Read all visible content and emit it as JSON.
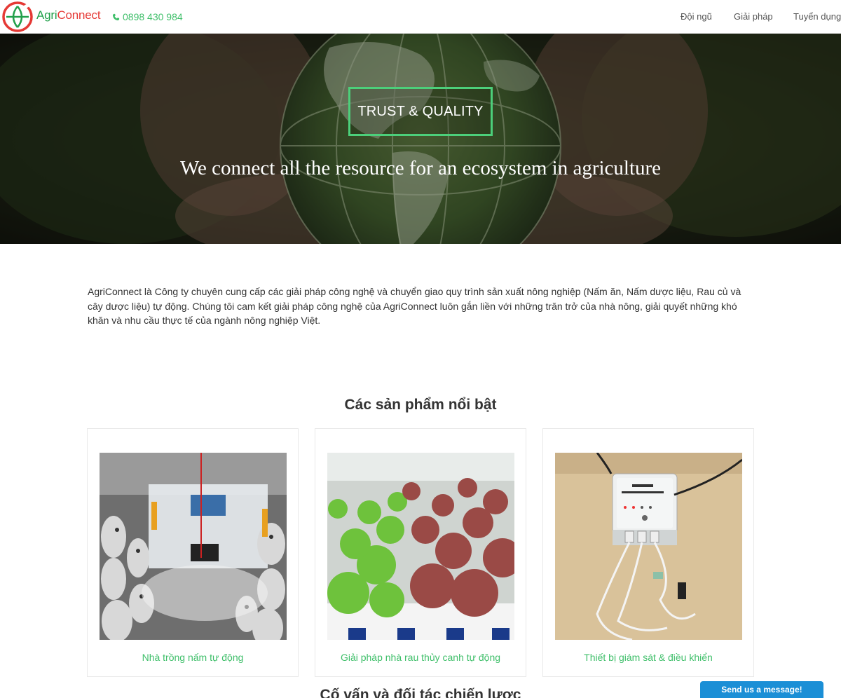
{
  "header": {
    "brand_part1": "Agri",
    "brand_part2": "Connect",
    "phone": "0898 430 984",
    "nav": [
      "Đội ngũ",
      "Giải pháp",
      "Tuyển dụng"
    ]
  },
  "hero": {
    "badge": "TRUST & QUALITY",
    "headline": "We connect all the resource for an ecosystem in agriculture"
  },
  "intro": {
    "text": "AgriConnect là Công ty chuyên cung cấp các giải pháp công nghệ và chuyển giao quy trình sản xuất nông nghiệp (Nấm ăn, Nấm dược liệu, Rau củ và cây dược liệu) tự động. Chúng tôi cam kết giải pháp công nghệ của AgriConnect luôn gắn liền với những trăn trở của nhà nông, giải quyết những khó khăn và nhu cầu thực tế của ngành nông nghiệp Việt."
  },
  "products": {
    "title": "Các sản phẩm nổi bật",
    "items": [
      {
        "caption": "Nhà trồng nấm tự động"
      },
      {
        "caption": "Giải pháp nhà rau thủy canh tự động"
      },
      {
        "caption": "Thiết bị giám sát & điều khiển"
      }
    ]
  },
  "partners": {
    "title": "Cố vấn và đối tác chiến lược"
  },
  "chat": {
    "label": "Send us a message!"
  },
  "colors": {
    "accent": "#3fbf6a",
    "brand_red": "#e53935",
    "chat_blue": "#1b8fd6"
  }
}
